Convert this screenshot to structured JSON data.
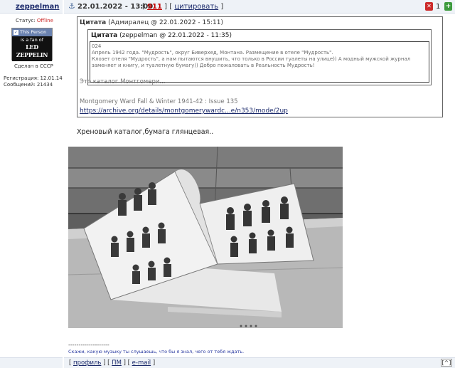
{
  "header": {
    "username": "zeppelman",
    "post_date": "22.01.2022 - 13:00",
    "post_number": "911",
    "quote_label": "цитировать",
    "rep_count": "1"
  },
  "user": {
    "status_label": "Статус:",
    "status_value": "Offline",
    "badge_top": "This Person",
    "badge_line1": "is a fan of",
    "badge_band": "LED ZEPPELIN",
    "made_in": "Сделан в СССР",
    "registration": "Регистрация: 12.01.14",
    "messages": "Сообщений: 21434"
  },
  "quote_outer": {
    "label": "Цитата",
    "meta": "(Адмиралец @ 22.01.2022 - 15:11)",
    "text1": "Это каталог Монтгомери...",
    "text2": "Montgomery Ward Fall & Winter 1941-42 : Issue 135",
    "link": "https://archive.org/details/montgomerywardc...e/n353/mode/2up"
  },
  "quote_inner": {
    "label": "Цитата",
    "meta": "(zeppelman @ 22.01.2022 - 11:35)",
    "line0": "024",
    "line1": "Апрель 1942 года. \"Мудрость\", округ Биверхед, Монтана. Размещение в отеле \"Мудрость\".",
    "line2": "Клозет отеля \"Мудрость\", а нам пытаются внушить, что только в России туалеты на улице)) А модный мужской журнал",
    "line3": "заменяет и книгу, и туалетную бумагу)) Добро пожаловать в Реальность Мудрость!"
  },
  "post": {
    "comment": "Хреновый каталог,бумага глянцевая.."
  },
  "signature": {
    "separator": "--------------------",
    "text": "Скажи, какую музыку ты слушаешь, что бы я знал, чего от тебя ждать."
  },
  "footer": {
    "profile": "профиль",
    "pm": "ПМ",
    "email": "e-mail",
    "top": "[^]"
  },
  "colors": {
    "header_bg": "#eef2f7",
    "link": "#1b2a6b",
    "post_number": "#c00000",
    "offline": "#cc2a2a"
  }
}
